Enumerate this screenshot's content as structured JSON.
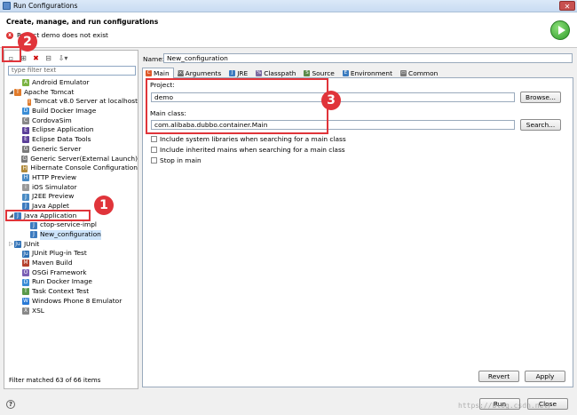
{
  "window": {
    "title": "Run Configurations",
    "close_glyph": "✕"
  },
  "header": {
    "title": "Create, manage, and run configurations",
    "error": "Project demo does not exist",
    "error_icon": "x"
  },
  "toolbar": {
    "new": "▫",
    "dup": "⊞",
    "delete": "✖",
    "collapse": "⊟",
    "filter": "⇩▾"
  },
  "filter": {
    "placeholder": "type filter text"
  },
  "tree": [
    {
      "label": "Android Emulator",
      "level": 1,
      "twisty": "",
      "icon": "A",
      "color": "#7cb342"
    },
    {
      "label": "Apache Tomcat",
      "level": 0,
      "twisty": "◢",
      "icon": "T",
      "color": "#e07a2a"
    },
    {
      "label": "Tomcat v8.0 Server at localhost",
      "level": 2,
      "twisty": "",
      "icon": "T",
      "color": "#e07a2a"
    },
    {
      "label": "Build Docker Image",
      "level": 1,
      "twisty": "",
      "icon": "D",
      "color": "#3a8dd6"
    },
    {
      "label": "CordovaSim",
      "level": 1,
      "twisty": "",
      "icon": "C",
      "color": "#888"
    },
    {
      "label": "Eclipse Application",
      "level": 1,
      "twisty": "",
      "icon": "E",
      "color": "#5b3f99"
    },
    {
      "label": "Eclipse Data Tools",
      "level": 1,
      "twisty": "",
      "icon": "E",
      "color": "#5b3f99"
    },
    {
      "label": "Generic Server",
      "level": 1,
      "twisty": "",
      "icon": "G",
      "color": "#7a7a7a"
    },
    {
      "label": "Generic Server(External Launch)",
      "level": 1,
      "twisty": "",
      "icon": "G",
      "color": "#7a7a7a"
    },
    {
      "label": "Hibernate Console Configuration",
      "level": 1,
      "twisty": "",
      "icon": "H",
      "color": "#b08a3a"
    },
    {
      "label": "HTTP Preview",
      "level": 1,
      "twisty": "",
      "icon": "H",
      "color": "#4a8bc4"
    },
    {
      "label": "iOS Simulator",
      "level": 1,
      "twisty": "",
      "icon": "i",
      "color": "#999"
    },
    {
      "label": "J2EE Preview",
      "level": 1,
      "twisty": "",
      "icon": "J",
      "color": "#4a8bc4"
    },
    {
      "label": "Java Applet",
      "level": 1,
      "twisty": "",
      "icon": "J",
      "color": "#3d7bbf"
    },
    {
      "label": "Java Application",
      "level": 0,
      "twisty": "◢",
      "icon": "J",
      "color": "#3d7bbf"
    },
    {
      "label": "ctop-service-impl",
      "level": 2,
      "twisty": "",
      "icon": "J",
      "color": "#3d7bbf"
    },
    {
      "label": "New_configuration",
      "level": 2,
      "twisty": "",
      "icon": "J",
      "color": "#3d7bbf",
      "selected": true
    },
    {
      "label": "JUnit",
      "level": 0,
      "twisty": "▷",
      "icon": "Ju",
      "color": "#2c6fb5"
    },
    {
      "label": "JUnit Plug-in Test",
      "level": 1,
      "twisty": "",
      "icon": "Ju",
      "color": "#2c6fb5"
    },
    {
      "label": "Maven Build",
      "level": 1,
      "twisty": "",
      "icon": "M",
      "color": "#b5402c"
    },
    {
      "label": "OSGi Framework",
      "level": 1,
      "twisty": "",
      "icon": "O",
      "color": "#7a5fb5"
    },
    {
      "label": "Run Docker Image",
      "level": 1,
      "twisty": "",
      "icon": "D",
      "color": "#3a8dd6"
    },
    {
      "label": "Task Context Test",
      "level": 1,
      "twisty": "",
      "icon": "T",
      "color": "#5a9a4a"
    },
    {
      "label": "Windows Phone 8 Emulator",
      "level": 1,
      "twisty": "",
      "icon": "W",
      "color": "#2a7ad6"
    },
    {
      "label": "XSL",
      "level": 1,
      "twisty": "",
      "icon": "X",
      "color": "#888"
    }
  ],
  "left_footer": "Filter matched 63 of 66 items",
  "config": {
    "name_label": "Name:",
    "name_value": "New_configuration",
    "tabs": [
      {
        "label": "Main",
        "icon": "C",
        "color": "#e05a2a",
        "active": true
      },
      {
        "label": "Arguments",
        "icon": "(x)",
        "color": "#6a6a6a"
      },
      {
        "label": "JRE",
        "icon": "J",
        "color": "#3d7bbf"
      },
      {
        "label": "Classpath",
        "icon": "%",
        "color": "#7a6aa0"
      },
      {
        "label": "Source",
        "icon": "S",
        "color": "#5a8a4a"
      },
      {
        "label": "Environment",
        "icon": "E",
        "color": "#3a7bbf"
      },
      {
        "label": "Common",
        "icon": "▭",
        "color": "#7a7a7a"
      }
    ],
    "project_label": "Project:",
    "project_value": "demo",
    "browse_label": "Browse...",
    "main_class_label": "Main class:",
    "main_class_value": "com.alibaba.dubbo.container.Main",
    "search_label": "Search...",
    "checkboxes": [
      "Include system libraries when searching for a main class",
      "Include inherited mains when searching for a main class",
      "Stop in main"
    ],
    "revert_label": "Revert",
    "apply_label": "Apply"
  },
  "footer": {
    "help": "?",
    "run_label": "Run",
    "close_label": "Close"
  },
  "annotations": {
    "badge1": "1",
    "badge2": "2",
    "badge3": "3"
  },
  "watermark": "https://blog.csdn.net/"
}
